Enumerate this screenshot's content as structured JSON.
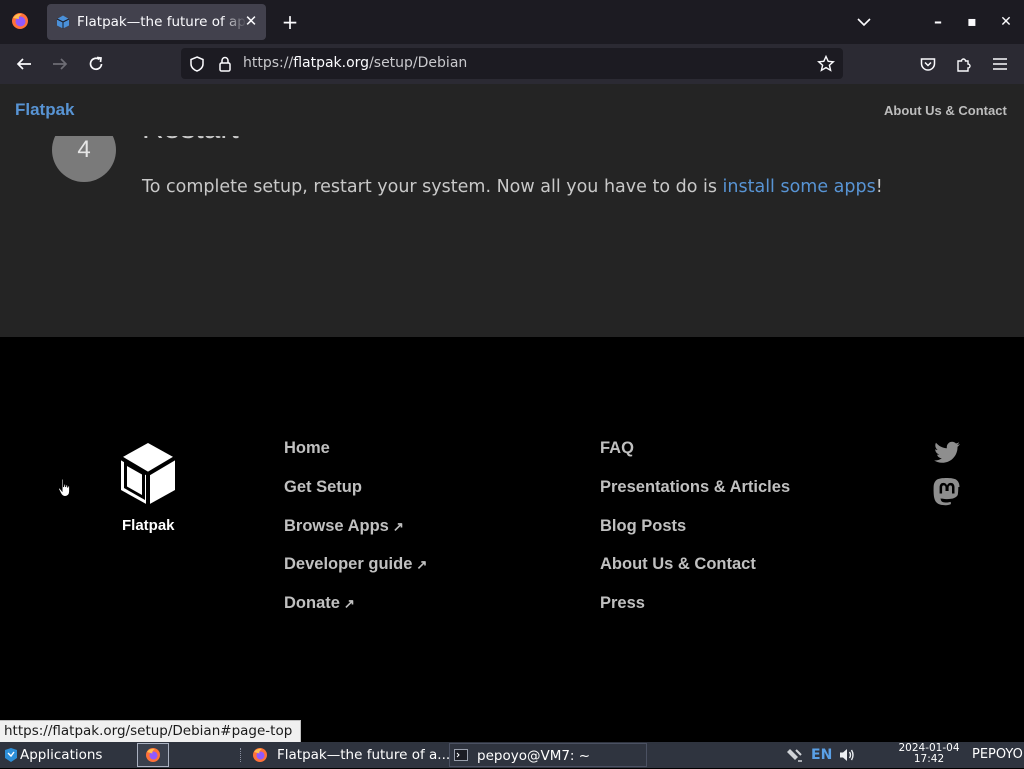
{
  "browser": {
    "tab": {
      "title": "Flatpak—the future of ap",
      "close_glyph": "✕"
    },
    "new_tab_glyph": "+",
    "url": {
      "prefix": "https://",
      "host": "flatpak.org",
      "path": "/setup/Debian"
    },
    "window_controls": {
      "minimize": "–",
      "maximize": "▪",
      "close": "✕"
    },
    "icons": {
      "back": "back-arrow-icon",
      "forward": "forward-arrow-icon",
      "reload": "reload-icon",
      "shield": "tracking-protection-icon",
      "lock": "lock-icon",
      "bookmark": "bookmark-star-icon",
      "pocket": "pocket-icon",
      "extensions": "extensions-icon",
      "menu": "hamburger-menu-icon",
      "tab_list": "chevron-down-icon"
    }
  },
  "site": {
    "brand": "Flatpak",
    "nav_about": "About Us & Contact",
    "step": {
      "number": "4",
      "title": "Restart",
      "text_before": "To complete setup, restart your system. Now all you have to do is ",
      "link": "install some apps",
      "text_after": "!"
    },
    "footer": {
      "logo_text": "Flatpak",
      "col1": [
        {
          "label": "Home",
          "external": false
        },
        {
          "label": "Get Setup",
          "external": false
        },
        {
          "label": "Browse Apps",
          "external": true
        },
        {
          "label": "Developer guide",
          "external": true
        },
        {
          "label": "Donate",
          "external": true
        }
      ],
      "col2": [
        {
          "label": "FAQ"
        },
        {
          "label": "Presentations & Articles"
        },
        {
          "label": "Blog Posts"
        },
        {
          "label": "About Us & Contact"
        },
        {
          "label": "Press"
        }
      ],
      "external_glyph": "↗",
      "social": [
        "twitter-icon",
        "mastodon-icon"
      ]
    }
  },
  "status_link": "https://flatpak.org/setup/Debian#page-top",
  "taskbar": {
    "applications": "Applications",
    "firefox_task": "Flatpak—the future of a...",
    "terminal_task": "pepoyo@VM7: ~",
    "keyboard_layout": "EN",
    "date": "2024-01-04",
    "time": "17:42",
    "user": "PEPOYO"
  },
  "colors": {
    "accent": "#5894d4",
    "footer_bg": "#000000",
    "content_bg": "#242424",
    "taskbar_bg": "#2f343f"
  }
}
